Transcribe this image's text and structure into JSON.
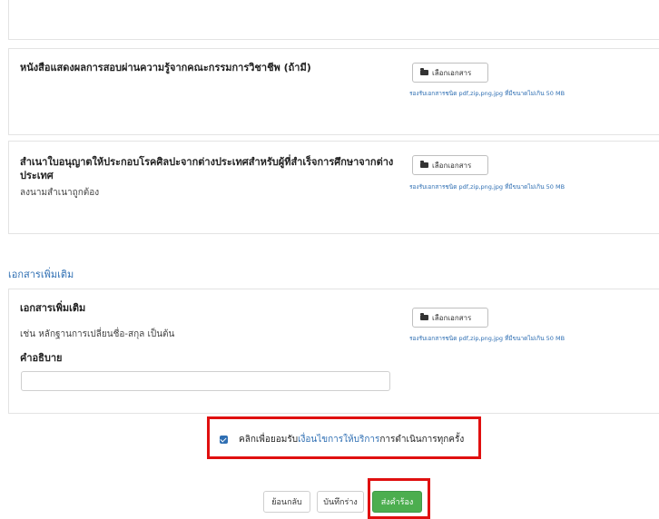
{
  "documents": [
    {
      "title": "หนังสือแสดงผลการสอบผ่านความรู้จากคณะกรรมการวิชาชีพ (ถ้ามี)",
      "button_label": "เลือกเอกสาร",
      "hint": "รองรับเอกสารชนิด pdf,zip,png,jpg ที่มีขนาดไม่เกิน 50 MB"
    },
    {
      "title_line1": "สำเนาใบอนุญาตให้ประกอบโรคศิลปะจากต่างประเทศสำหรับผู้ที่สำเร็จการศึกษาจากต่าง",
      "title_line2": "ประเทศ",
      "note": "ลงนามสำเนาถูกต้อง",
      "button_label": "เลือกเอกสาร",
      "hint": "รองรับเอกสารชนิด pdf,zip,png,jpg ที่มีขนาดไม่เกิน 50 MB"
    }
  ],
  "additional": {
    "section_title": "เอกสารเพิ่มเติม",
    "title": "เอกสารเพิ่มเติม",
    "example": "เช่น หลักฐานการเปลี่ยนชื่อ-สกุล เป็นต้น",
    "description_label": "คำอธิบาย",
    "description_value": "",
    "button_label": "เลือกเอกสาร",
    "hint": "รองรับเอกสารชนิด pdf,zip,png,jpg ที่มีขนาดไม่เกิน 50 MB"
  },
  "agreement": {
    "checked": true,
    "prefix": "คลิกเพื่อยอมรับ",
    "link": "เงื่อนไขการให้บริการ",
    "suffix": "การดำเนินการทุกครั้ง"
  },
  "actions": {
    "back": "ย้อนกลับ",
    "save_draft": "บันทึกร่าง",
    "submit": "ส่งคำร้อง"
  },
  "colors": {
    "accent": "#2f6fb3",
    "submit": "#4cae4f",
    "highlight": "#e01010"
  }
}
